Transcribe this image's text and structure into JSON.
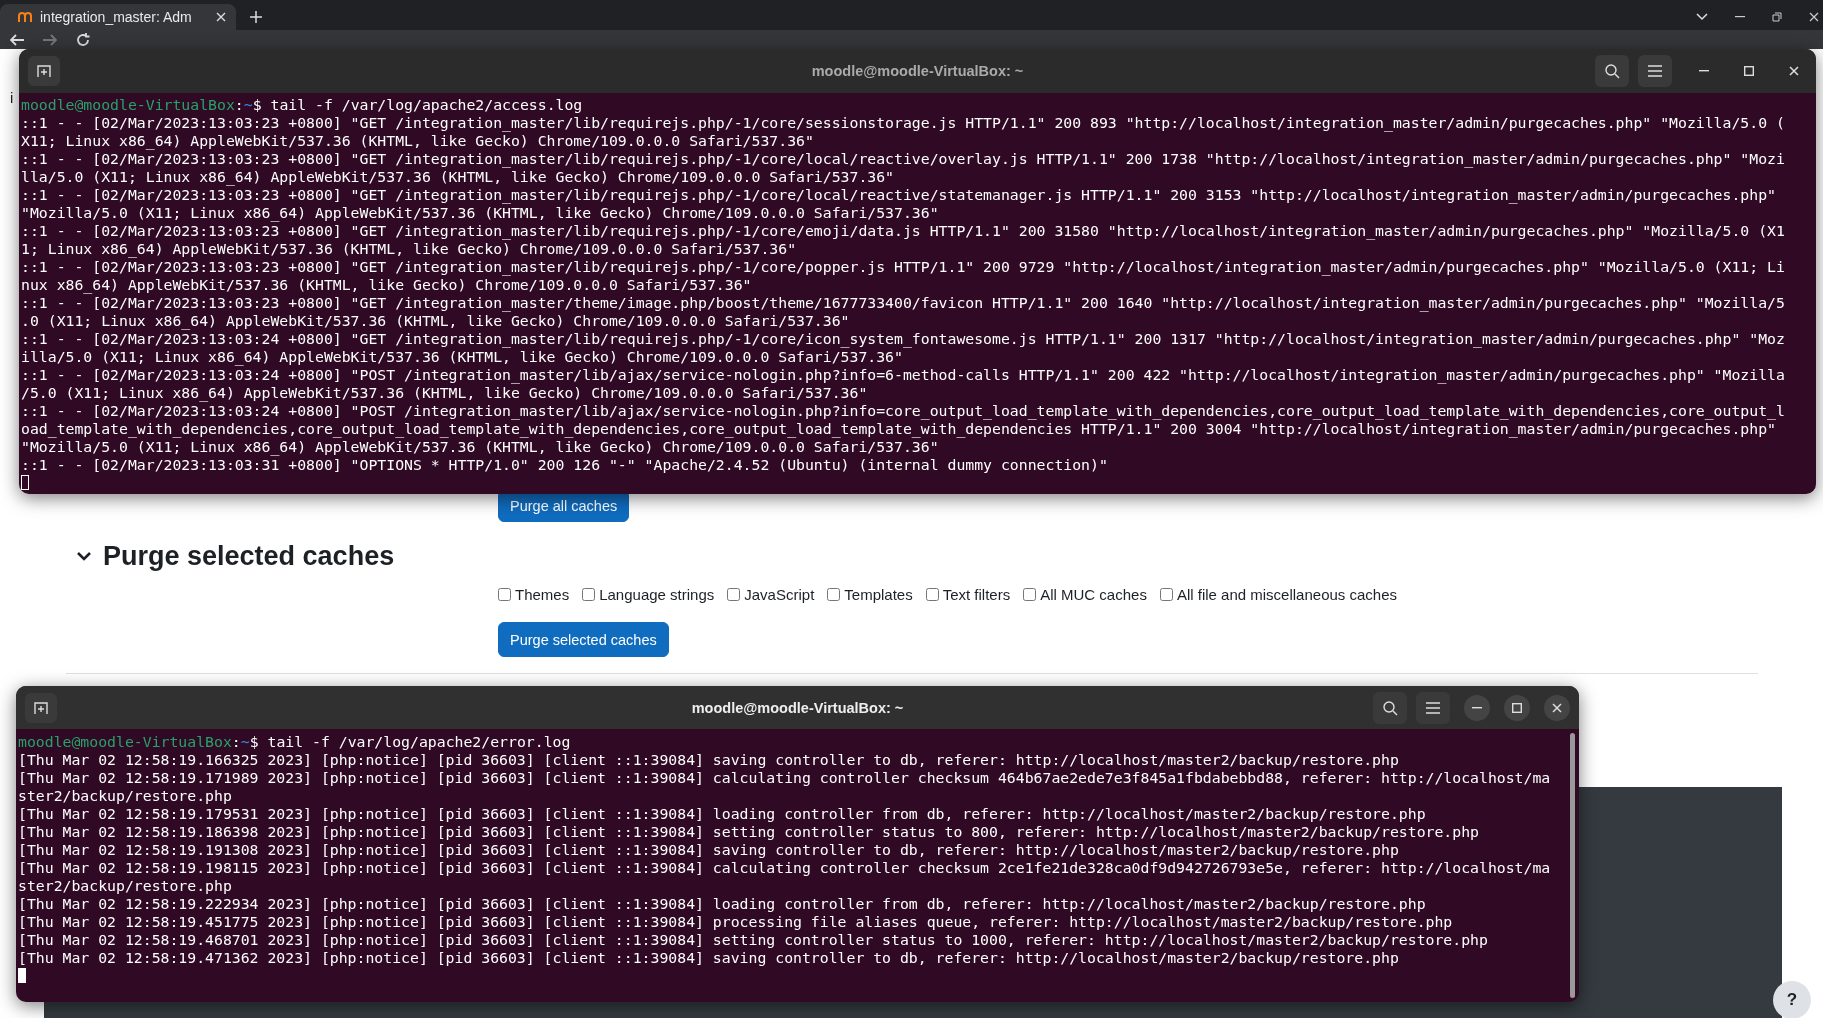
{
  "browser": {
    "tabs": [
      {
        "title": "integration_master: Adm",
        "selected": true
      }
    ]
  },
  "page": {
    "fragment": "i",
    "purge_all_button": "Purge all caches",
    "section": {
      "title": "Purge selected caches",
      "expanded": true,
      "options": [
        {
          "label": "Themes",
          "checked": false
        },
        {
          "label": "Language strings",
          "checked": false
        },
        {
          "label": "JavaScript",
          "checked": false
        },
        {
          "label": "Templates",
          "checked": false
        },
        {
          "label": "Text filters",
          "checked": false
        },
        {
          "label": "All MUC caches",
          "checked": false
        },
        {
          "label": "All file and miscellaneous caches",
          "checked": false
        }
      ],
      "button": "Purge selected caches"
    }
  },
  "terminals": [
    {
      "title": "moodle@moodle-VirtualBox: ~",
      "focused": false,
      "prompt": {
        "user_host": "moodle@moodle-VirtualBox",
        "separator": ":",
        "path": "~",
        "command": "$ tail -f /var/log/apache2/access.log"
      },
      "lines": [
        "::1 - - [02/Mar/2023:13:03:23 +0800] \"GET /integration_master/lib/requirejs.php/-1/core/sessionstorage.js HTTP/1.1\" 200 893 \"http://localhost/integration_master/admin/purgecaches.php\" \"Mozilla/5.0 (",
        "X11; Linux x86_64) AppleWebKit/537.36 (KHTML, like Gecko) Chrome/109.0.0.0 Safari/537.36\"",
        "::1 - - [02/Mar/2023:13:03:23 +0800] \"GET /integration_master/lib/requirejs.php/-1/core/local/reactive/overlay.js HTTP/1.1\" 200 1738 \"http://localhost/integration_master/admin/purgecaches.php\" \"Mozi",
        "lla/5.0 (X11; Linux x86_64) AppleWebKit/537.36 (KHTML, like Gecko) Chrome/109.0.0.0 Safari/537.36\"",
        "::1 - - [02/Mar/2023:13:03:23 +0800] \"GET /integration_master/lib/requirejs.php/-1/core/local/reactive/statemanager.js HTTP/1.1\" 200 3153 \"http://localhost/integration_master/admin/purgecaches.php\"",
        "\"Mozilla/5.0 (X11; Linux x86_64) AppleWebKit/537.36 (KHTML, like Gecko) Chrome/109.0.0.0 Safari/537.36\"",
        "::1 - - [02/Mar/2023:13:03:23 +0800] \"GET /integration_master/lib/requirejs.php/-1/core/emoji/data.js HTTP/1.1\" 200 31580 \"http://localhost/integration_master/admin/purgecaches.php\" \"Mozilla/5.0 (X1",
        "1; Linux x86_64) AppleWebKit/537.36 (KHTML, like Gecko) Chrome/109.0.0.0 Safari/537.36\"",
        "::1 - - [02/Mar/2023:13:03:23 +0800] \"GET /integration_master/lib/requirejs.php/-1/core/popper.js HTTP/1.1\" 200 9729 \"http://localhost/integration_master/admin/purgecaches.php\" \"Mozilla/5.0 (X11; Li",
        "nux x86_64) AppleWebKit/537.36 (KHTML, like Gecko) Chrome/109.0.0.0 Safari/537.36\"",
        "::1 - - [02/Mar/2023:13:03:23 +0800] \"GET /integration_master/theme/image.php/boost/theme/1677733400/favicon HTTP/1.1\" 200 1640 \"http://localhost/integration_master/admin/purgecaches.php\" \"Mozilla/5",
        ".0 (X11; Linux x86_64) AppleWebKit/537.36 (KHTML, like Gecko) Chrome/109.0.0.0 Safari/537.36\"",
        "::1 - - [02/Mar/2023:13:03:24 +0800] \"GET /integration_master/lib/requirejs.php/-1/core/icon_system_fontawesome.js HTTP/1.1\" 200 1317 \"http://localhost/integration_master/admin/purgecaches.php\" \"Moz",
        "illa/5.0 (X11; Linux x86_64) AppleWebKit/537.36 (KHTML, like Gecko) Chrome/109.0.0.0 Safari/537.36\"",
        "::1 - - [02/Mar/2023:13:03:24 +0800] \"POST /integration_master/lib/ajax/service-nologin.php?info=6-method-calls HTTP/1.1\" 200 422 \"http://localhost/integration_master/admin/purgecaches.php\" \"Mozilla",
        "/5.0 (X11; Linux x86_64) AppleWebKit/537.36 (KHTML, like Gecko) Chrome/109.0.0.0 Safari/537.36\"",
        "::1 - - [02/Mar/2023:13:03:24 +0800] \"POST /integration_master/lib/ajax/service-nologin.php?info=core_output_load_template_with_dependencies,core_output_load_template_with_dependencies,core_output_l",
        "oad_template_with_dependencies,core_output_load_template_with_dependencies,core_output_load_template_with_dependencies HTTP/1.1\" 200 3004 \"http://localhost/integration_master/admin/purgecaches.php\"",
        "\"Mozilla/5.0 (X11; Linux x86_64) AppleWebKit/537.36 (KHTML, like Gecko) Chrome/109.0.0.0 Safari/537.36\"",
        "::1 - - [02/Mar/2023:13:03:31 +0800] \"OPTIONS * HTTP/1.0\" 200 126 \"-\" \"Apache/2.4.52 (Ubuntu) (internal dummy connection)\""
      ]
    },
    {
      "title": "moodle@moodle-VirtualBox: ~",
      "focused": true,
      "prompt": {
        "user_host": "moodle@moodle-VirtualBox",
        "separator": ":",
        "path": "~",
        "command": "$ tail -f /var/log/apache2/error.log"
      },
      "lines": [
        "[Thu Mar 02 12:58:19.166325 2023] [php:notice] [pid 36603] [client ::1:39084] saving controller to db, referer: http://localhost/master2/backup/restore.php",
        "[Thu Mar 02 12:58:19.171989 2023] [php:notice] [pid 36603] [client ::1:39084] calculating controller checksum 464b67ae2ede7e3f845a1fbdabebbd88, referer: http://localhost/ma",
        "ster2/backup/restore.php",
        "[Thu Mar 02 12:58:19.179531 2023] [php:notice] [pid 36603] [client ::1:39084] loading controller from db, referer: http://localhost/master2/backup/restore.php",
        "[Thu Mar 02 12:58:19.186398 2023] [php:notice] [pid 36603] [client ::1:39084] setting controller status to 800, referer: http://localhost/master2/backup/restore.php",
        "[Thu Mar 02 12:58:19.191308 2023] [php:notice] [pid 36603] [client ::1:39084] saving controller to db, referer: http://localhost/master2/backup/restore.php",
        "[Thu Mar 02 12:58:19.198115 2023] [php:notice] [pid 36603] [client ::1:39084] calculating controller checksum 2ce1fe21de328ca0df9d942726793e5e, referer: http://localhost/ma",
        "ster2/backup/restore.php",
        "[Thu Mar 02 12:58:19.222934 2023] [php:notice] [pid 36603] [client ::1:39084] loading controller from db, referer: http://localhost/master2/backup/restore.php",
        "[Thu Mar 02 12:58:19.451775 2023] [php:notice] [pid 36603] [client ::1:39084] processing file aliases queue, referer: http://localhost/master2/backup/restore.php",
        "[Thu Mar 02 12:58:19.468701 2023] [php:notice] [pid 36603] [client ::1:39084] setting controller status to 1000, referer: http://localhost/master2/backup/restore.php",
        "[Thu Mar 02 12:58:19.471362 2023] [php:notice] [pid 36603] [client ::1:39084] saving controller to db, referer: http://localhost/master2/backup/restore.php"
      ]
    }
  ],
  "help_button": "?"
}
